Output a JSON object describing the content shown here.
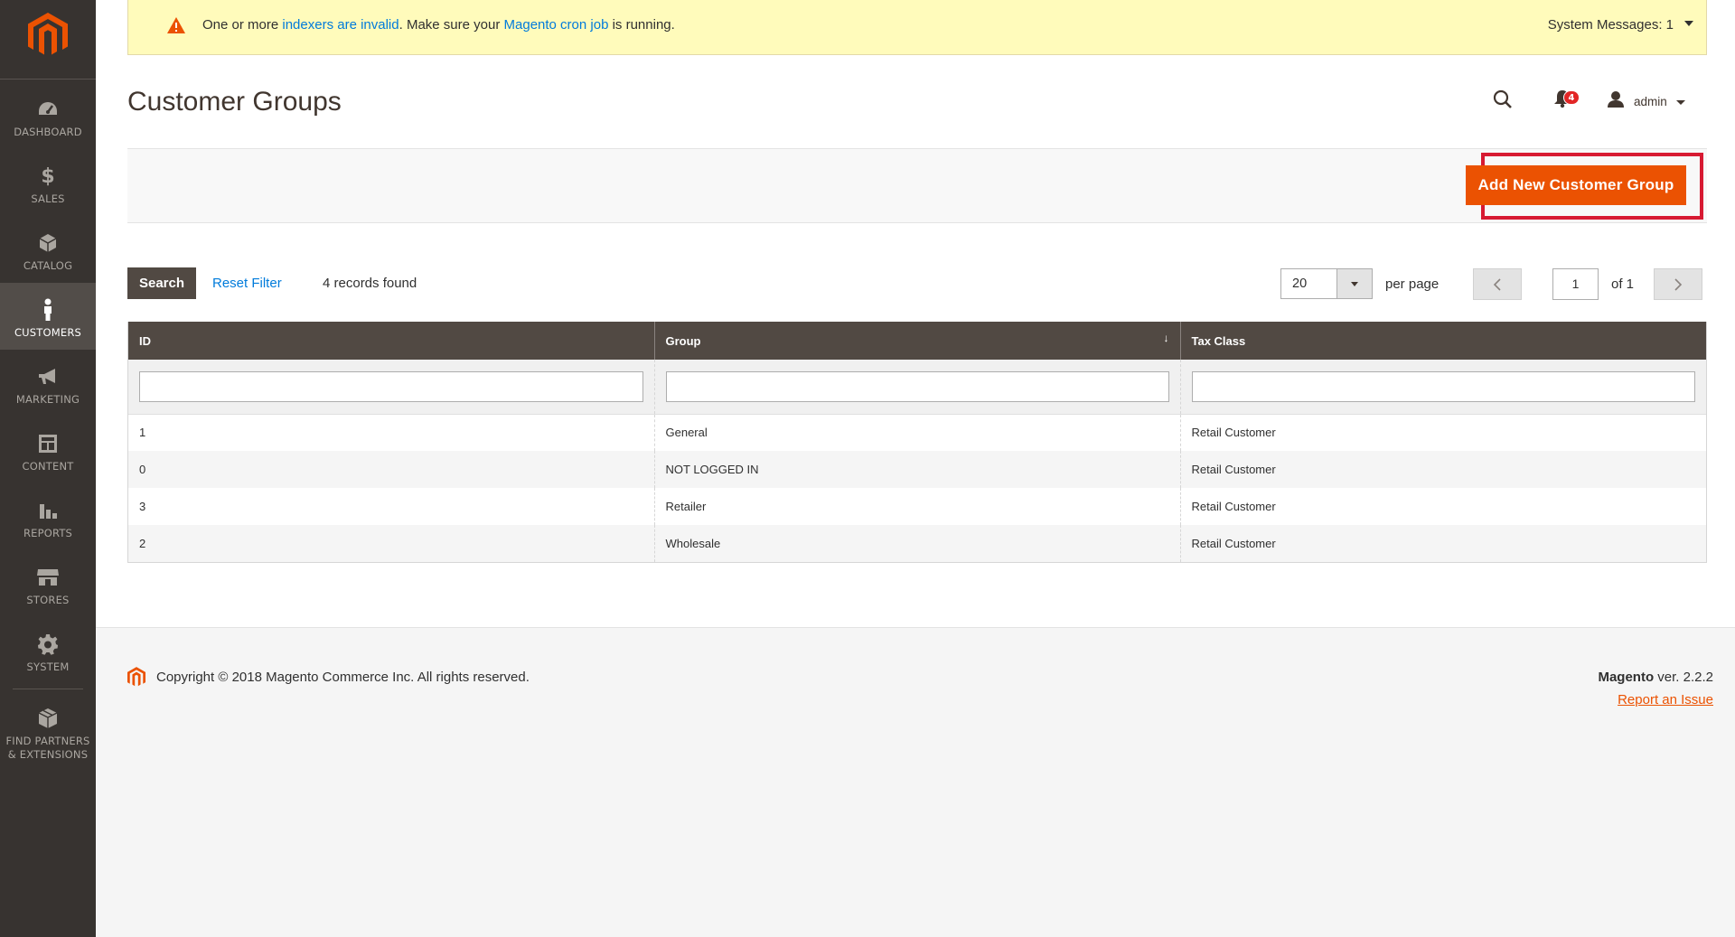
{
  "sidebar": {
    "items": [
      {
        "label": "DASHBOARD",
        "icon": "speedometer-icon"
      },
      {
        "label": "SALES",
        "icon": "dollar-icon"
      },
      {
        "label": "CATALOG",
        "icon": "box-icon"
      },
      {
        "label": "CUSTOMERS",
        "icon": "person-icon",
        "active": true
      },
      {
        "label": "MARKETING",
        "icon": "megaphone-icon"
      },
      {
        "label": "CONTENT",
        "icon": "layout-icon"
      },
      {
        "label": "REPORTS",
        "icon": "bar-chart-icon"
      },
      {
        "label": "STORES",
        "icon": "storefront-icon"
      },
      {
        "label": "SYSTEM",
        "icon": "gear-icon"
      },
      {
        "label": "FIND PARTNERS & EXTENSIONS",
        "icon": "cubes-icon"
      }
    ]
  },
  "system_message": {
    "prefix": "One or more ",
    "link1": "indexers are invalid",
    "middle": ". Make sure your ",
    "link2": "Magento cron job",
    "suffix": " is running.",
    "count": "System Messages: 1"
  },
  "header": {
    "title": "Customer Groups",
    "notifications_count": "4",
    "user": "admin"
  },
  "actions": {
    "add_button": "Add New Customer Group"
  },
  "grid_toolbar": {
    "search_button": "Search",
    "reset_filter": "Reset Filter",
    "records_found": "4 records found",
    "per_page_value": "20",
    "per_page_label": "per page",
    "page_value": "1",
    "page_of": "of 1"
  },
  "table": {
    "columns": [
      "ID",
      "Group",
      "Tax Class"
    ],
    "rows": [
      {
        "id": "1",
        "group": "General",
        "tax_class": "Retail Customer"
      },
      {
        "id": "0",
        "group": "NOT LOGGED IN",
        "tax_class": "Retail Customer"
      },
      {
        "id": "3",
        "group": "Retailer",
        "tax_class": "Retail Customer"
      },
      {
        "id": "2",
        "group": "Wholesale",
        "tax_class": "Retail Customer"
      }
    ]
  },
  "footer": {
    "copyright": "Copyright © 2018 Magento Commerce Inc. All rights reserved.",
    "brand": "Magento",
    "version": " ver. 2.2.2",
    "report_issue": "Report an Issue"
  },
  "colors": {
    "sidebar_bg": "#373330",
    "accent_orange": "#eb5202",
    "table_header": "#514943",
    "highlight_red": "#d71a32",
    "link_blue": "#007bdb",
    "message_bg": "#fffbbb"
  }
}
